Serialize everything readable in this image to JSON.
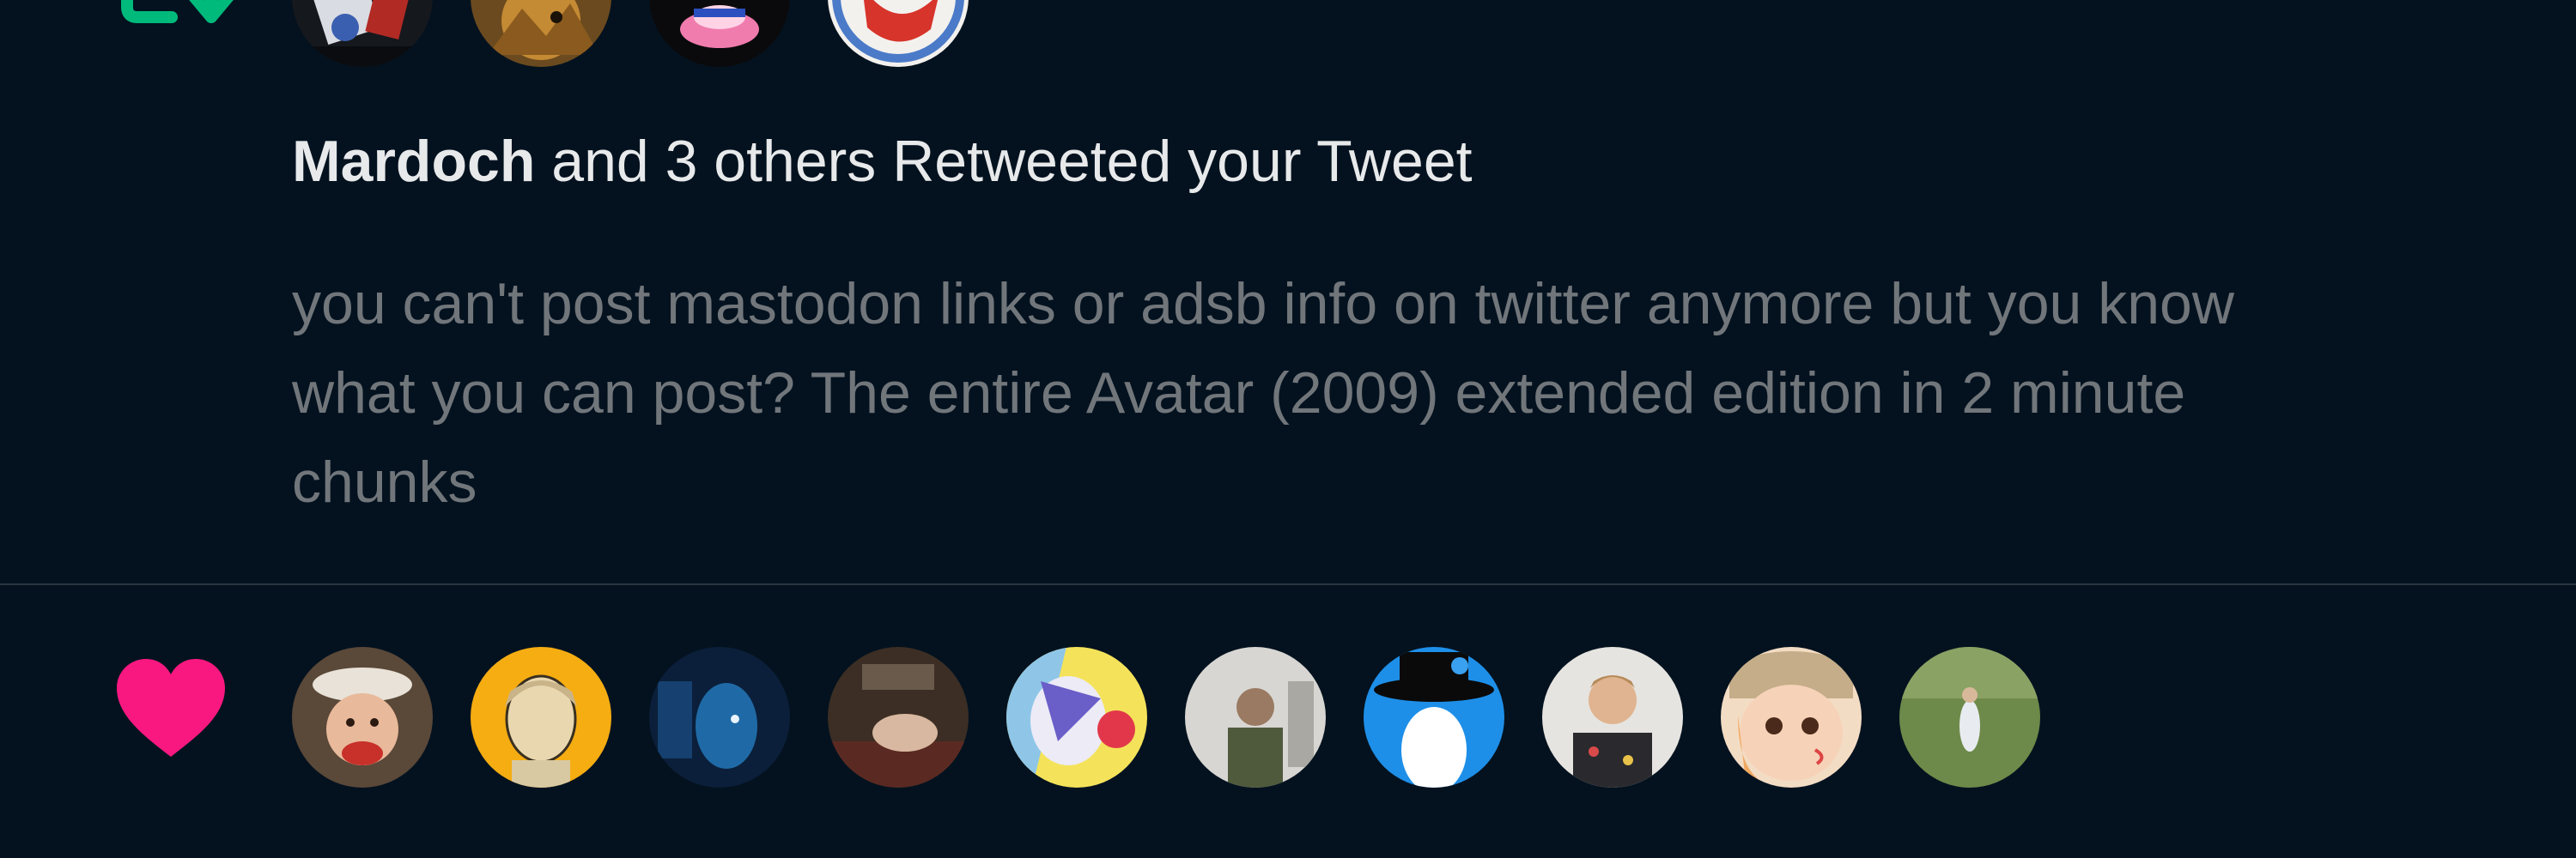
{
  "colors": {
    "background": "#04121f",
    "divider": "#2b3540",
    "retweet_green": "#00ba7c",
    "like_pink": "#f91880",
    "primary_text": "#e7e9ea",
    "secondary_text": "#71767b"
  },
  "notifications": [
    {
      "type": "retweet",
      "icon": "retweet-icon",
      "avatar_count": 4,
      "actor": "Mardoch",
      "action": " and 3 others Retweeted your Tweet",
      "tweet_text_lines": [
        "you can't post mastodon links or adsb info on twitter anymore but you know",
        "what you can post? The entire Avatar (2009) extended edition in 2 minute",
        "chunks"
      ]
    },
    {
      "type": "like",
      "icon": "heart-icon",
      "avatar_count": 10
    }
  ]
}
